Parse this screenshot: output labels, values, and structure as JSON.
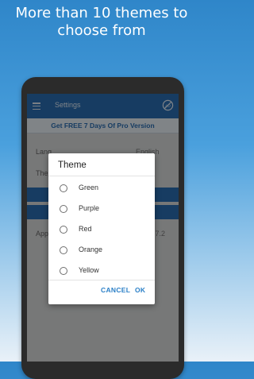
{
  "promo": {
    "line1": "More than 10 themes to",
    "line2": "choose from"
  },
  "appbar": {
    "title": "Settings",
    "menu_icon": "hamburger-menu-icon",
    "noads_icon": "no-ads-icon"
  },
  "pro_banner": "Get FREE 7 Days Of Pro Version",
  "settings": {
    "language_label": "Lang",
    "language_value": "English",
    "theme_label": "The",
    "app_label": "App",
    "version_value": ".7.2"
  },
  "dialog": {
    "title": "Theme",
    "options": [
      {
        "label": "Green"
      },
      {
        "label": "Purple"
      },
      {
        "label": "Red"
      },
      {
        "label": "Orange"
      },
      {
        "label": "Yellow"
      }
    ],
    "cancel_label": "CANCEL",
    "ok_label": "OK"
  },
  "colors": {
    "primary": "#2a6eb3",
    "accent": "#2a7fc7",
    "background_top": "#2f86c9"
  }
}
